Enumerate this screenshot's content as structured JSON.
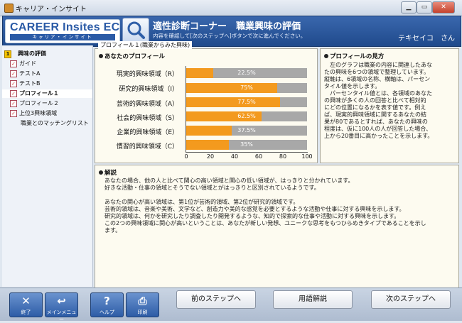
{
  "window": {
    "title": "キャリア・インサイト"
  },
  "header": {
    "logo_main": "CAREER Insites EC",
    "logo_sub": "キャリア・インサイト",
    "title": "適性診断コーナー　職業興味の評価",
    "subtitle": "内容を確認して[次のステップへ]ボタンで次に進んでください。",
    "user": "テキセイコ　さん"
  },
  "sidebar": {
    "items": [
      {
        "label": "興味の評価",
        "type": "root"
      },
      {
        "label": "ガイド",
        "type": "check"
      },
      {
        "label": "テストA",
        "type": "check"
      },
      {
        "label": "テストB",
        "type": "check"
      },
      {
        "label": "プロフィール１",
        "type": "active"
      },
      {
        "label": "プロフィール２",
        "type": "check"
      },
      {
        "label": "上位3興味領域",
        "type": "check"
      },
      {
        "label": "職業とのマッチングリスト",
        "type": "plain"
      }
    ]
  },
  "breadcrumb": "プロフィール１(職業からみた興味)",
  "profile": {
    "heading": "あなたのプロフィール",
    "chart_data": {
      "type": "bar",
      "orientation": "horizontal",
      "categories": [
        "現実的興味領域（R）",
        "研究的興味領域（I）",
        "芸術的興味領域（A）",
        "社会的興味領域（S）",
        "企業的興味領域（E）",
        "慣習的興味領域（C）"
      ],
      "values": [
        22.5,
        75,
        77.5,
        62.5,
        37.5,
        35
      ],
      "value_labels": [
        "22.5%",
        "75%",
        "77.5%",
        "62.5%",
        "37.5%",
        "35%"
      ],
      "xlim": [
        0,
        100
      ],
      "xticks": [
        "0",
        "20",
        "40",
        "60",
        "80",
        "100"
      ],
      "colors": {
        "fill": "#f39a1e",
        "background": "#a8a8a8"
      }
    }
  },
  "view": {
    "heading": "プロフィールの見方",
    "lines": [
      "　左のグラフは職業の内容に関連したあな",
      "たの興味を6つの領域で整理しています。",
      "縦軸は、6領域の名称、横軸は、パーセン",
      "タイル値を示します。",
      "　パーセンタイル値とは、各領域のあなた",
      "の興味が多くの人の回答と比べて相対的",
      "にどの位置になるかを表す値です。例え",
      "ば、現実的興味領域に関するあなたの結",
      "果が80であるとすれば、あなたの興味の",
      "程度は、仮に100人の人が回答した場合、",
      "上から20番目に高かったことを示します。"
    ]
  },
  "explanation": {
    "heading": "解説",
    "lines": [
      "　あなたの場合、他の人と比べて関心の高い領域と関心の低い領域が、はっきりと分かれています。",
      "　好きな活動・仕事の領域とそうでない領域とがはっきりと区別されているようです。",
      "",
      "　あなたの関心が高い領域は、第1位が芸術的領域、第2位が研究的領域です。",
      "　芸術的領域は、音楽や美術、文学など、創造力や美的な感覚を必要とするような活動や仕事に対する興味を示します。",
      "　研究的領域は、何かを研究したり調査したり開発するような、知的で探索的な仕事や活動に対する興味を示します。",
      "　この2つの興味領域に関心が高いということは、あなたが新しい発想、ユニークな思考をもつひらめきタイプであることを示し",
      "　ます。"
    ]
  },
  "footer": {
    "icons": [
      {
        "label": "終了",
        "glyph": "✕",
        "icon": "close-icon"
      },
      {
        "label": "メインメニュー",
        "glyph": "↩",
        "icon": "return-icon"
      },
      {
        "label": "ヘルプ",
        "glyph": "?",
        "icon": "help-icon"
      },
      {
        "label": "印刷",
        "glyph": "⎙",
        "icon": "print-icon"
      }
    ],
    "prev": "前のステップへ",
    "terms": "用語解説",
    "next": "次のステップへ"
  }
}
